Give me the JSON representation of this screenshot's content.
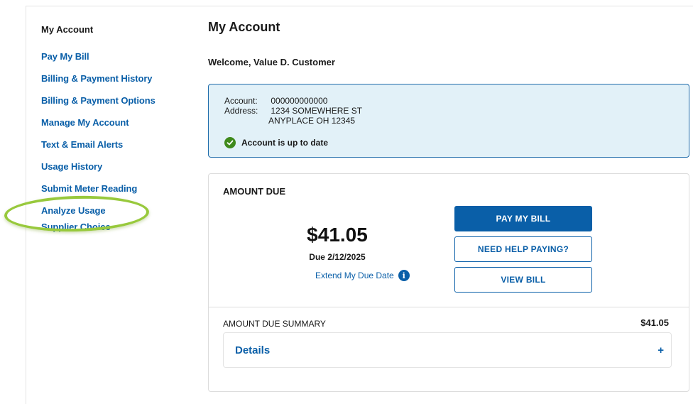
{
  "sidebar": {
    "title": "My Account",
    "items": [
      {
        "label": "Pay My Bill"
      },
      {
        "label": "Billing & Payment History"
      },
      {
        "label": "Billing & Payment Options"
      },
      {
        "label": "Manage My Account"
      },
      {
        "label": "Text & Email Alerts"
      },
      {
        "label": "Usage History"
      },
      {
        "label": "Submit Meter Reading"
      },
      {
        "label": "Analyze Usage"
      },
      {
        "label": "Supplier Choice"
      }
    ],
    "highlighted_item": "Analyze Usage",
    "highlight_color": "#98c93c"
  },
  "main": {
    "title": "My Account",
    "welcome": "Welcome, Value D. Customer",
    "account": {
      "account_label": "Account:",
      "account_number": "000000000000",
      "address_label": "Address:",
      "address_line1": "1234 SOMEWHERE ST",
      "address_line2": "ANYPLACE OH 12345",
      "status": "Account is up to date",
      "status_icon": "check-circle-icon",
      "status_color": "#3f8a1c"
    },
    "amount_due": {
      "heading": "AMOUNT DUE",
      "amount": "$41.05",
      "due_date": "Due 2/12/2025",
      "extend_link": "Extend My Due Date",
      "buttons": {
        "pay": "PAY MY BILL",
        "help": "NEED HELP PAYING?",
        "view": "VIEW BILL"
      },
      "summary_label": "AMOUNT DUE SUMMARY",
      "summary_value": "$41.05",
      "details_label": "Details",
      "details_toggle": "+"
    }
  },
  "colors": {
    "link": "#0a5fa8",
    "primary_button": "#0a5fa8",
    "account_box_bg": "#e2f1f8",
    "account_box_border": "#1f6cab"
  }
}
